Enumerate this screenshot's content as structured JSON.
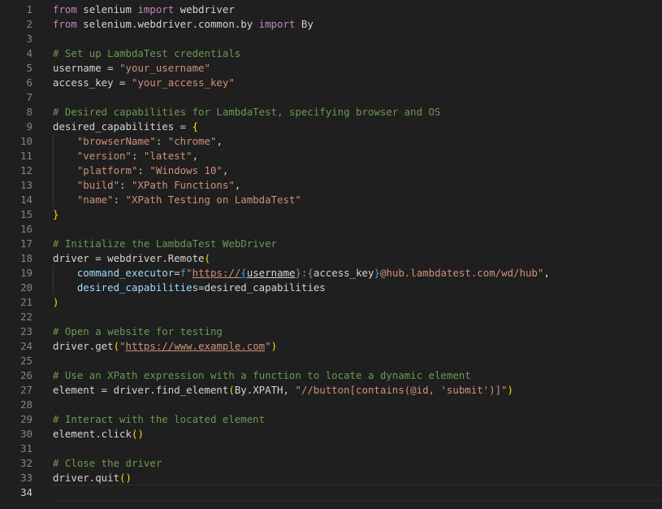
{
  "editor": {
    "lines": [
      {
        "n": "1",
        "t": [
          {
            "c": "kw",
            "v": "from"
          },
          {
            "c": "",
            "v": " selenium "
          },
          {
            "c": "kw",
            "v": "import"
          },
          {
            "c": "",
            "v": " webdriver"
          }
        ]
      },
      {
        "n": "2",
        "t": [
          {
            "c": "kw",
            "v": "from"
          },
          {
            "c": "",
            "v": " selenium.webdriver.common.by "
          },
          {
            "c": "kw",
            "v": "import"
          },
          {
            "c": "",
            "v": " By"
          }
        ]
      },
      {
        "n": "3",
        "t": []
      },
      {
        "n": "4",
        "t": [
          {
            "c": "cm",
            "v": "# Set up LambdaTest credentials"
          }
        ]
      },
      {
        "n": "5",
        "t": [
          {
            "c": "",
            "v": "username = "
          },
          {
            "c": "st",
            "v": "\"your_username\""
          }
        ]
      },
      {
        "n": "6",
        "t": [
          {
            "c": "",
            "v": "access_key = "
          },
          {
            "c": "st",
            "v": "\"your_access_key\""
          }
        ]
      },
      {
        "n": "7",
        "t": []
      },
      {
        "n": "8",
        "t": [
          {
            "c": "cm",
            "v": "# Desired capabilities for LambdaTest, specifying browser and OS"
          }
        ]
      },
      {
        "n": "9",
        "t": [
          {
            "c": "",
            "v": "desired_capabilities = "
          },
          {
            "c": "br1",
            "v": "{"
          }
        ]
      },
      {
        "n": "10",
        "guide": true,
        "t": [
          {
            "c": "",
            "v": "    "
          },
          {
            "c": "st",
            "v": "\"browserName\""
          },
          {
            "c": "",
            "v": ": "
          },
          {
            "c": "st",
            "v": "\"chrome\""
          },
          {
            "c": "",
            "v": ","
          }
        ]
      },
      {
        "n": "11",
        "guide": true,
        "t": [
          {
            "c": "",
            "v": "    "
          },
          {
            "c": "st",
            "v": "\"version\""
          },
          {
            "c": "",
            "v": ": "
          },
          {
            "c": "st",
            "v": "\"latest\""
          },
          {
            "c": "",
            "v": ","
          }
        ]
      },
      {
        "n": "12",
        "guide": true,
        "t": [
          {
            "c": "",
            "v": "    "
          },
          {
            "c": "st",
            "v": "\"platform\""
          },
          {
            "c": "",
            "v": ": "
          },
          {
            "c": "st",
            "v": "\"Windows 10\""
          },
          {
            "c": "",
            "v": ","
          }
        ]
      },
      {
        "n": "13",
        "guide": true,
        "t": [
          {
            "c": "",
            "v": "    "
          },
          {
            "c": "st",
            "v": "\"build\""
          },
          {
            "c": "",
            "v": ": "
          },
          {
            "c": "st",
            "v": "\"XPath Functions\""
          },
          {
            "c": "",
            "v": ","
          }
        ]
      },
      {
        "n": "14",
        "guide": true,
        "t": [
          {
            "c": "",
            "v": "    "
          },
          {
            "c": "st",
            "v": "\"name\""
          },
          {
            "c": "",
            "v": ": "
          },
          {
            "c": "st",
            "v": "\"XPath Testing on LambdaTest\""
          }
        ]
      },
      {
        "n": "15",
        "t": [
          {
            "c": "br1",
            "v": "}"
          }
        ]
      },
      {
        "n": "16",
        "t": []
      },
      {
        "n": "17",
        "t": [
          {
            "c": "cm",
            "v": "# Initialize the LambdaTest WebDriver"
          }
        ]
      },
      {
        "n": "18",
        "t": [
          {
            "c": "",
            "v": "driver = webdriver.Remote"
          },
          {
            "c": "br1",
            "v": "("
          }
        ]
      },
      {
        "n": "19",
        "guide": true,
        "t": [
          {
            "c": "",
            "v": "    "
          },
          {
            "c": "pr",
            "v": "command_executor"
          },
          {
            "c": "",
            "v": "="
          },
          {
            "c": "fs",
            "v": "f"
          },
          {
            "c": "st",
            "v": "\""
          },
          {
            "c": "st ul",
            "v": "https://"
          },
          {
            "c": "fs ul",
            "v": "{"
          },
          {
            "c": "ul",
            "v": "username"
          },
          {
            "c": "fs",
            "v": "}"
          },
          {
            "c": "st",
            "v": ":"
          },
          {
            "c": "fs",
            "v": "{"
          },
          {
            "c": "",
            "v": "access_key"
          },
          {
            "c": "fs",
            "v": "}"
          },
          {
            "c": "st",
            "v": "@hub.lambdatest.com/wd/hub\""
          },
          {
            "c": "",
            "v": ","
          }
        ]
      },
      {
        "n": "20",
        "guide": true,
        "t": [
          {
            "c": "",
            "v": "    "
          },
          {
            "c": "pr",
            "v": "desired_capabilities"
          },
          {
            "c": "",
            "v": "=desired_capabilities"
          }
        ]
      },
      {
        "n": "21",
        "t": [
          {
            "c": "br1",
            "v": ")"
          }
        ]
      },
      {
        "n": "22",
        "t": []
      },
      {
        "n": "23",
        "t": [
          {
            "c": "cm",
            "v": "# Open a website for testing"
          }
        ]
      },
      {
        "n": "24",
        "t": [
          {
            "c": "",
            "v": "driver.get"
          },
          {
            "c": "br1",
            "v": "("
          },
          {
            "c": "st",
            "v": "\""
          },
          {
            "c": "st ul",
            "v": "https://www.example.com"
          },
          {
            "c": "st",
            "v": "\""
          },
          {
            "c": "br1",
            "v": ")"
          }
        ]
      },
      {
        "n": "25",
        "t": []
      },
      {
        "n": "26",
        "t": [
          {
            "c": "cm",
            "v": "# Use an XPath expression with a function to locate a dynamic element"
          }
        ]
      },
      {
        "n": "27",
        "t": [
          {
            "c": "",
            "v": "element = driver.find_element"
          },
          {
            "c": "br1",
            "v": "("
          },
          {
            "c": "",
            "v": "By.XPATH, "
          },
          {
            "c": "st",
            "v": "\"//button[contains(@id, 'submit')]\""
          },
          {
            "c": "br1",
            "v": ")"
          }
        ]
      },
      {
        "n": "28",
        "t": []
      },
      {
        "n": "29",
        "t": [
          {
            "c": "cm",
            "v": "# Interact with the located element"
          }
        ]
      },
      {
        "n": "30",
        "t": [
          {
            "c": "",
            "v": "element.click"
          },
          {
            "c": "br1",
            "v": "()"
          }
        ]
      },
      {
        "n": "31",
        "t": []
      },
      {
        "n": "32",
        "t": [
          {
            "c": "cm",
            "v": "# Close the driver"
          }
        ]
      },
      {
        "n": "33",
        "t": [
          {
            "c": "",
            "v": "driver.quit"
          },
          {
            "c": "br1",
            "v": "()"
          }
        ]
      },
      {
        "n": "34",
        "current": true,
        "t": []
      }
    ]
  }
}
